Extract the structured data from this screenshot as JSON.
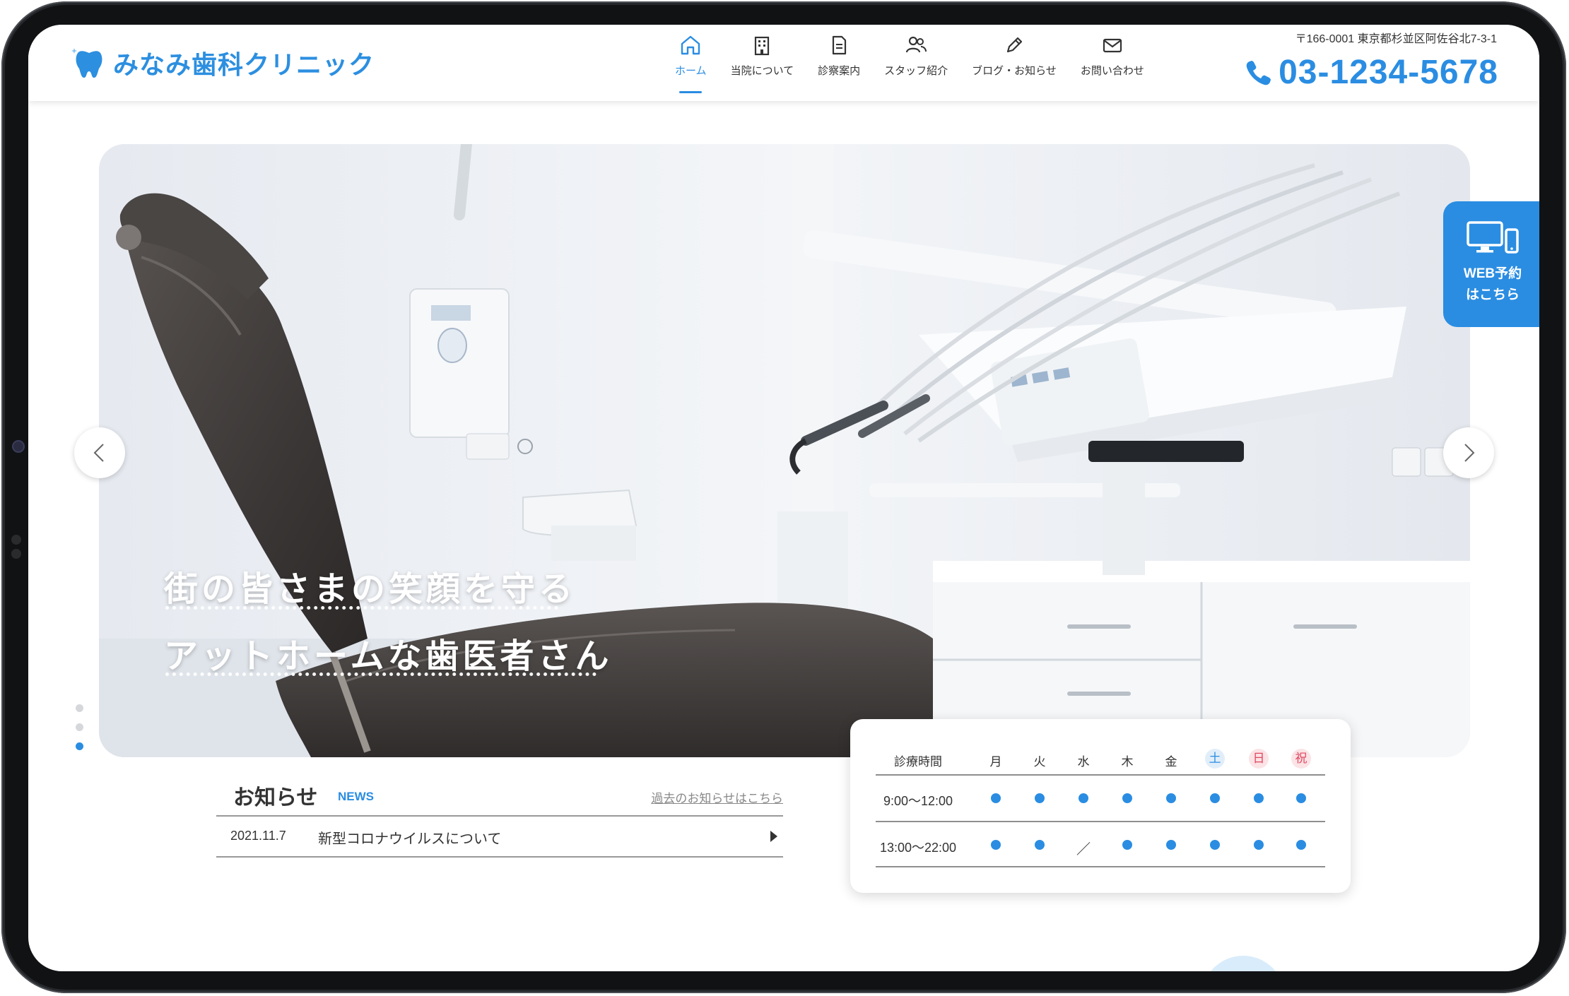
{
  "header": {
    "logo_text": "みなみ歯科クリニック",
    "address": "〒166-0001 東京都杉並区阿佐谷北7-3-1",
    "phone": "03-1234-5678",
    "nav": [
      {
        "label": "ホーム",
        "icon": "home-icon",
        "active": true
      },
      {
        "label": "当院について",
        "icon": "building-icon",
        "active": false
      },
      {
        "label": "診察案内",
        "icon": "document-icon",
        "active": false
      },
      {
        "label": "スタッフ紹介",
        "icon": "staff-icon",
        "active": false
      },
      {
        "label": "ブログ・お知らせ",
        "icon": "pencil-icon",
        "active": false
      },
      {
        "label": "お問い合わせ",
        "icon": "mail-icon",
        "active": false
      }
    ]
  },
  "hero": {
    "tagline_1": "街の皆さまの笑顔を守る",
    "tagline_2": "アットホームな歯医者さん",
    "slides_total": 3,
    "active_slide": 3
  },
  "web_booking": {
    "line_1": "WEB予約",
    "line_2": "はこちら"
  },
  "news": {
    "title": "お知らせ",
    "title_en": "NEWS",
    "more_link": "過去のお知らせはこちら",
    "items": [
      {
        "date": "2021.11.7",
        "text": "新型コロナウイルスについて"
      }
    ]
  },
  "hours": {
    "header_label": "診療時間",
    "days": [
      "月",
      "火",
      "水",
      "木",
      "金",
      "土",
      "日",
      "祝"
    ],
    "rows": [
      {
        "time": "9:00〜12:00",
        "marks": [
          "●",
          "●",
          "●",
          "●",
          "●",
          "●",
          "●",
          "●"
        ]
      },
      {
        "time": "13:00〜22:00",
        "marks": [
          "●",
          "●",
          "／",
          "●",
          "●",
          "●",
          "●",
          "●"
        ]
      }
    ]
  },
  "colors": {
    "accent": "#2a8de2",
    "saturday": "#2a8de2",
    "sunday": "#e0475e"
  }
}
